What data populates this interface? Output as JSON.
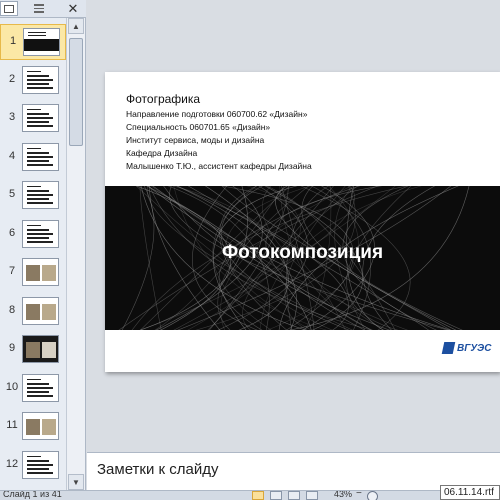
{
  "panel": {
    "tabs": [
      {
        "name": "slides",
        "icon": "slides-tab-icon"
      },
      {
        "name": "outline",
        "icon": "outline-tab-icon"
      }
    ],
    "close_glyph": "✕",
    "thumbnails": [
      {
        "num": "1",
        "style": "title",
        "selected": true
      },
      {
        "num": "2",
        "style": "text"
      },
      {
        "num": "3",
        "style": "text"
      },
      {
        "num": "4",
        "style": "text"
      },
      {
        "num": "5",
        "style": "text"
      },
      {
        "num": "6",
        "style": "text"
      },
      {
        "num": "7",
        "style": "photo"
      },
      {
        "num": "8",
        "style": "photo"
      },
      {
        "num": "9",
        "style": "photo-dark"
      },
      {
        "num": "10",
        "style": "text"
      },
      {
        "num": "11",
        "style": "photo"
      },
      {
        "num": "12",
        "style": "text"
      }
    ]
  },
  "slide": {
    "header": "Фотографика",
    "lines": [
      "Направление подготовки 060700.62 «Дизайн»",
      "Специальность 060701.65 «Дизайн»",
      "Институт сервиса, моды и дизайна",
      "Кафедра  Дизайна",
      "Малышенко  Т.Ю., ассистент кафедры Дизайна"
    ],
    "title": "Фотокомпозиция",
    "logo_text": "ВГУЭС",
    "colors": {
      "band": "#0c0c0c",
      "logo": "#1c4fa0"
    }
  },
  "notes": {
    "placeholder": "Заметки к слайду"
  },
  "status": {
    "slide_counter": "Слайд 1 из 41",
    "zoom": "43%",
    "minus": "−"
  },
  "tooltip": "06.11.14.rtf"
}
